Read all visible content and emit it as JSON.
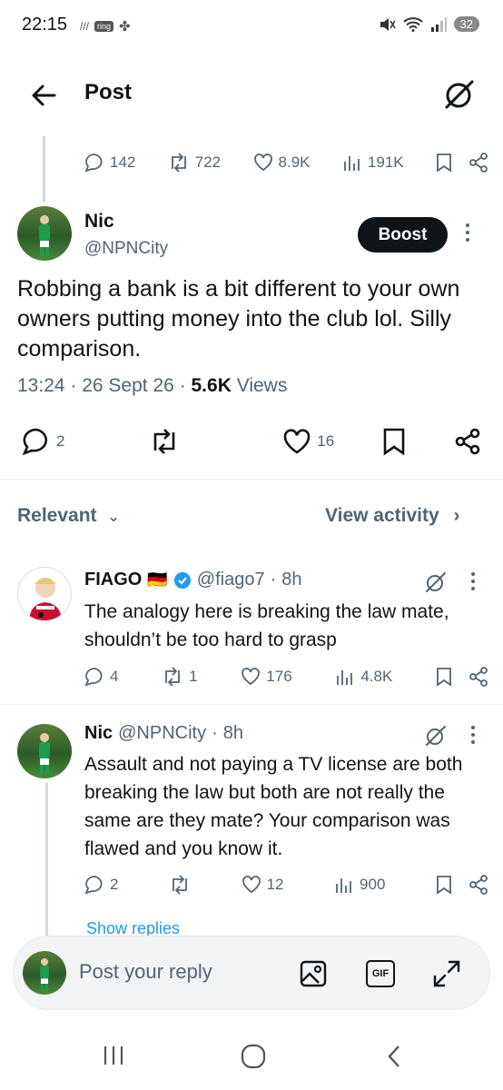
{
  "status_bar": {
    "time": "22:15",
    "ring_label": "ring",
    "battery": "32"
  },
  "header": {
    "title": "Post"
  },
  "parent_metrics": {
    "replies": "142",
    "reposts": "722",
    "likes": "8.9K",
    "views": "191K"
  },
  "main_tweet": {
    "name": "Nic",
    "handle": "@NPNCity",
    "boost_label": "Boost",
    "text": "Robbing a bank is a bit different to your own owners putting money into the club lol. Silly comparison.",
    "time": "13:24",
    "date": "26 Sept 26",
    "views_count": "5.6K",
    "views_label": "Views",
    "replies": "2",
    "likes": "16"
  },
  "sort": {
    "relevant_label": "Relevant",
    "view_activity_label": "View activity"
  },
  "replies": [
    {
      "name": "FIAGO",
      "flag": "🇩🇪",
      "handle": "@fiago7",
      "age": "8h",
      "text": "The analogy here is breaking the law mate, shouldn’t be too hard to grasp",
      "replies": "4",
      "reposts": "1",
      "likes": "176",
      "views": "4.8K"
    },
    {
      "name": "Nic",
      "handle": "@NPNCity",
      "age": "8h",
      "text": "Assault and not paying a TV license are both breaking the law but both are not really the same are they mate? Your comparison was flawed and you know it.",
      "replies": "2",
      "likes": "12",
      "views": "900"
    }
  ],
  "show_replies_label": "Show replies",
  "composer": {
    "placeholder": "Post your reply",
    "gif_label": "GIF"
  },
  "colors": {
    "text": "#0f1419",
    "muted": "#536471",
    "accent": "#1d9bf0",
    "verified": "#1d9bf0"
  }
}
